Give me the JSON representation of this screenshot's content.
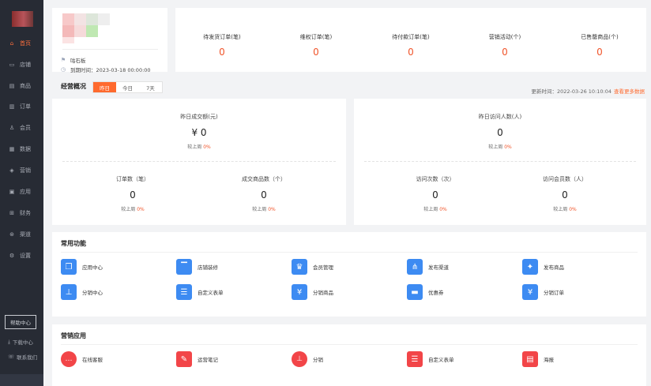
{
  "sidebar": {
    "items": [
      {
        "label": "首页",
        "icon": "home-icon",
        "glyph": "⌂",
        "active": true
      },
      {
        "label": "店铺",
        "icon": "store-icon",
        "glyph": "▭"
      },
      {
        "label": "商品",
        "icon": "goods-icon",
        "glyph": "▤"
      },
      {
        "label": "订单",
        "icon": "order-icon",
        "glyph": "▥"
      },
      {
        "label": "会员",
        "icon": "user-icon",
        "glyph": "♙"
      },
      {
        "label": "数据",
        "icon": "data-icon",
        "glyph": "▦"
      },
      {
        "label": "营销",
        "icon": "tag-icon",
        "glyph": "◈"
      },
      {
        "label": "应用",
        "icon": "app-icon",
        "glyph": "▣"
      },
      {
        "label": "财务",
        "icon": "finance-icon",
        "glyph": "⊞"
      },
      {
        "label": "渠道",
        "icon": "channel-icon",
        "glyph": "⊛"
      },
      {
        "label": "设置",
        "icon": "settings-icon",
        "glyph": "⚙"
      }
    ],
    "help": "帮助中心",
    "download": "下载中心",
    "contact": "联系我们"
  },
  "shop": {
    "name": "咕石板",
    "expire": "到期时间：2023-03-18 00:00:00"
  },
  "order_stats": [
    {
      "label": "待发货订单(笔)",
      "value": "0"
    },
    {
      "label": "维权订单(笔)",
      "value": "0"
    },
    {
      "label": "待付款订单(笔)",
      "value": "0"
    },
    {
      "label": "营销活动(个)",
      "value": "0"
    },
    {
      "label": "已售罄商品(个)",
      "value": "0"
    }
  ],
  "overview": {
    "title": "经营概况",
    "tabs": [
      "昨日",
      "今日",
      "7天"
    ],
    "active_tab": 0,
    "update_time": "更新时间：2022-03-26 10:10:04",
    "more_link": "查看更多数据",
    "compare_label": "较上周",
    "left": {
      "main": {
        "label": "昨日成交额(元)",
        "value": "¥ 0",
        "change": "0%"
      },
      "a": {
        "label": "订单数（笔）",
        "value": "0",
        "change": "0%"
      },
      "b": {
        "label": "成交商品数（个）",
        "value": "0",
        "change": "0%"
      }
    },
    "right": {
      "main": {
        "label": "昨日访问人数(人)",
        "value": "0",
        "change": "0%"
      },
      "a": {
        "label": "访问次数（次）",
        "value": "0",
        "change": "0%"
      },
      "b": {
        "label": "访问会员数（人）",
        "value": "0",
        "change": "0%"
      }
    }
  },
  "functions": {
    "title": "常用功能",
    "items": [
      {
        "label": "应用中心",
        "icon": "cube-icon",
        "glyph": "❒"
      },
      {
        "label": "店铺装修",
        "icon": "paint-roller-icon",
        "glyph": "▔"
      },
      {
        "label": "会员管理",
        "icon": "crown-icon",
        "glyph": "♛"
      },
      {
        "label": "发布渠道",
        "icon": "share-icon",
        "glyph": "⋔"
      },
      {
        "label": "发布商品",
        "icon": "shirt-icon",
        "glyph": "✦"
      },
      {
        "label": "分销中心",
        "icon": "org-chart-icon",
        "glyph": "⊥"
      },
      {
        "label": "自定义表单",
        "icon": "form-icon",
        "glyph": "☰"
      },
      {
        "label": "分销商品",
        "icon": "distribute-goods-icon",
        "glyph": "¥"
      },
      {
        "label": "优惠券",
        "icon": "coupon-icon",
        "glyph": "▬"
      },
      {
        "label": "分销订单",
        "icon": "distribute-order-icon",
        "glyph": "¥"
      }
    ]
  },
  "marketing": {
    "title": "营销应用",
    "items": [
      {
        "label": "在线客服",
        "icon": "chat-icon",
        "glyph": "…"
      },
      {
        "label": "运营笔记",
        "icon": "note-icon",
        "glyph": "✎"
      },
      {
        "label": "分销",
        "icon": "org-chart-icon",
        "glyph": "⊥"
      },
      {
        "label": "自定义表单",
        "icon": "form-icon",
        "glyph": "☰"
      },
      {
        "label": "海报",
        "icon": "poster-icon",
        "glyph": "▤"
      }
    ]
  },
  "colors": {
    "accent": "#ff6a2e",
    "sidebar": "#272b34",
    "blue": "#3d8bf2",
    "red": "#f24548"
  }
}
